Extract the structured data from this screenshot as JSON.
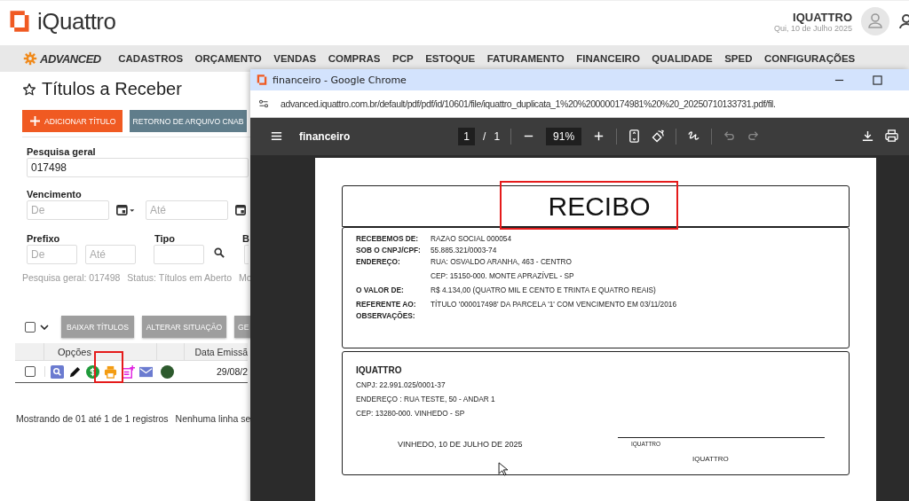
{
  "app": {
    "logo": "iQuattro",
    "user": "IQUATTRO",
    "date": "Qui, 10 de Julho 2025",
    "brand": "ADVANCED",
    "menu": [
      "CADASTROS",
      "ORÇAMENTO",
      "VENDAS",
      "COMPRAS",
      "PCP",
      "ESTOQUE",
      "FATURAMENTO",
      "FINANCEIRO",
      "QUALIDADE",
      "SPED",
      "CONFIGURAÇÕES"
    ]
  },
  "page": {
    "title": "Títulos a Receber",
    "buttons": [
      {
        "label": "ADICIONAR TÍTULO",
        "kind": "primary"
      },
      {
        "label": "RETORNO DE ARQUIVO CNAB",
        "kind": "secondary"
      }
    ]
  },
  "filters": {
    "search": {
      "label": "Pesquisa geral",
      "value": "017498"
    },
    "due": {
      "label": "Vencimento",
      "from_placeholder": "De",
      "to_placeholder": "Até"
    },
    "prefix": {
      "label": "Prefixo",
      "from_placeholder": "De",
      "to_placeholder": "Até"
    },
    "type": {
      "label": "Tipo"
    },
    "column_4_label": "B"
  },
  "summary": [
    "Pesquisa geral: 017498",
    "Status: Títulos em Aberto",
    "Mo"
  ],
  "actions": {
    "select_all": {
      "checked": false
    },
    "buttons": [
      "BAIXAR TÍTULOS",
      "ALTERAR SITUAÇÃO",
      "GE"
    ]
  },
  "table": {
    "columns": [
      "Opções",
      "Data Emissã"
    ],
    "rows": [
      {
        "checked": false,
        "color": "#2d5a2d",
        "date": "29/08/2"
      }
    ]
  },
  "footer": [
    "Mostrando de 01 até 1 de 1 registros",
    "Nenhuma linha se"
  ],
  "browser": {
    "title": "financeiro - Google Chrome",
    "url": "advanced.iquattro.com.br/default/pdf/pdf/id/10601/file/iquattro_duplicata_1%20%200000174981%20%20_20250710133731.pdf/fil.",
    "pdf": {
      "title": "financeiro",
      "page": "1",
      "separator": "/",
      "pages": "1",
      "zoom": "91%"
    },
    "receipt": {
      "title": "RECIBO",
      "fields": [
        {
          "label": "RECEBEMOS DE:",
          "lines": [
            "RAZAO SOCIAL 000054"
          ]
        },
        {
          "label": "SOB O CNPJ/CPF:",
          "lines": [
            "55.885.321/0003-74"
          ]
        },
        {
          "label": "ENDEREÇO:",
          "lines": [
            "RUA: OSVALDO ARANHA, 463 - CENTRO",
            "CEP: 15150-000. MONTE APRAZÍVEL - SP"
          ]
        },
        {
          "label": "O VALOR DE:",
          "lines": [
            "R$ 4.134,00 (QUATRO MIL E CENTO E TRINTA E QUATRO REAIS)"
          ]
        },
        {
          "label": "REFERENTE AO:",
          "lines": [
            "TÍTULO '000017498' DA PARCELA '1' COM VENCIMENTO EM 03/11/2016"
          ]
        },
        {
          "label": "OBSERVAÇÕES:"
        }
      ],
      "company": {
        "name": "IQUATTRO",
        "lines": [
          "CNPJ: 22.991.025/0001-37",
          "ENDEREÇO : RUA TESTE, 50 - ANDAR 1",
          "CEP: 13280-000. VINHEDO - SP"
        ]
      },
      "place_date": "VINHEDO, 10 DE JULHO DE 2025",
      "signature_caption": "IQUATTRO",
      "signer": "IQUATTRO"
    }
  }
}
